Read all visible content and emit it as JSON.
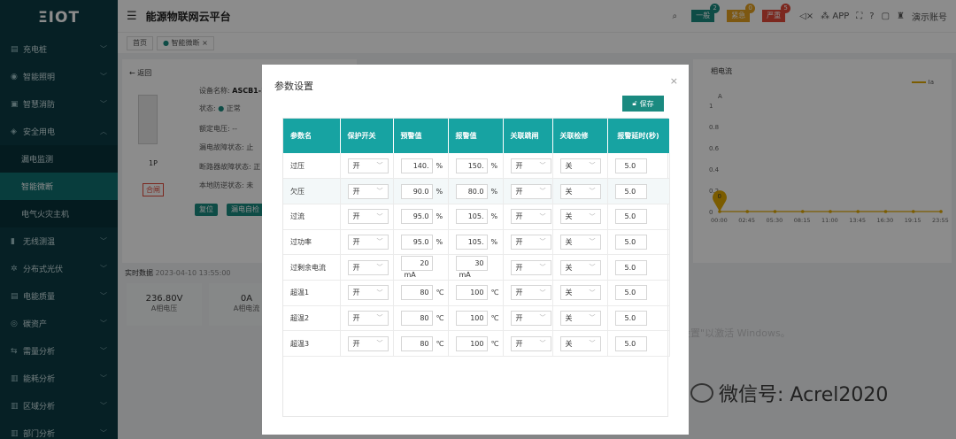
{
  "logo": "ΞIOT",
  "app_title": "能源物联网云平台",
  "sidebar": {
    "items": [
      {
        "label": "充电桩",
        "icon": "▤"
      },
      {
        "label": "智能照明",
        "icon": "◉"
      },
      {
        "label": "智慧消防",
        "icon": "▣"
      },
      {
        "label": "安全用电",
        "icon": "◈"
      },
      {
        "label": "漏电监测",
        "icon": ""
      },
      {
        "label": "智能微断",
        "icon": ""
      },
      {
        "label": "电气火灾主机",
        "icon": ""
      },
      {
        "label": "无线测温",
        "icon": "▮"
      },
      {
        "label": "分布式光伏",
        "icon": "✲"
      },
      {
        "label": "电能质量",
        "icon": "▤"
      },
      {
        "label": "碳资产",
        "icon": "◎"
      },
      {
        "label": "需量分析",
        "icon": "⇆"
      },
      {
        "label": "能耗分析",
        "icon": "▥"
      },
      {
        "label": "区域分析",
        "icon": "▥"
      },
      {
        "label": "部门分析",
        "icon": "▥"
      }
    ]
  },
  "topbar": {
    "alarms": [
      {
        "label": "一般",
        "count": "2",
        "color": "#1a8a80"
      },
      {
        "label": "紧急",
        "count": "0",
        "color": "#e4a01f"
      },
      {
        "label": "严重",
        "count": "5",
        "color": "#e24a3a"
      }
    ],
    "app_label": "APP",
    "user": "演示账号"
  },
  "tabs": [
    {
      "label": "首页"
    },
    {
      "label": "智能微断"
    }
  ],
  "device": {
    "back": "返回",
    "name_label": "设备名称:",
    "name_value": "ASCB1-1",
    "status_label": "状态:",
    "status_value": "正常",
    "voltage_label": "额定电压:",
    "voltage_value": "--",
    "leak_label": "漏电故障状态:",
    "leak_value": "止",
    "breaker_label": "断路器故障状态:",
    "breaker_value": "正",
    "local_label": "本地防逆状态:",
    "local_value": "未",
    "pole": "1P",
    "state": "合闸",
    "btn_reset": "复位",
    "btn_selfcheck": "漏电自检"
  },
  "realtime": {
    "title": "实时数据",
    "time": "2023-04-10 13:55:00",
    "cards": [
      {
        "value": "236.80V",
        "label": "A相电压"
      },
      {
        "value": "0A",
        "label": "A相电流"
      }
    ]
  },
  "chart_data": {
    "type": "line",
    "title": "相电流",
    "ylabel": "A",
    "legend": [
      "Ia"
    ],
    "x": [
      "00:00",
      "02:45",
      "05:30",
      "08:15",
      "11:00",
      "13:45",
      "16:30",
      "19:15",
      "23:55"
    ],
    "yticks": [
      "0",
      "0.2",
      "0.4",
      "0.6",
      "0.8",
      "1"
    ],
    "ylim": [
      0,
      1
    ],
    "series": [
      {
        "name": "Ia",
        "values": [
          0,
          0,
          0,
          0,
          0,
          0,
          0,
          0,
          0
        ]
      }
    ],
    "marker_value": "0",
    "color": "#e0a800",
    "grid": false
  },
  "watermark": "转到\"设置\"以激活 Windows。",
  "wechat_text": "微信号: Acrel2020",
  "modal": {
    "title": "参数设置",
    "save_label": "保存",
    "columns": [
      "参数名",
      "保护开关",
      "预警值",
      "报警值",
      "关联跳闸",
      "关联检修",
      "报警延时(秒)"
    ],
    "rows": [
      {
        "name": "过压",
        "switch": "开",
        "warn": "140.",
        "warn_unit": "%",
        "alarm": "150.",
        "alarm_unit": "%",
        "trip": "开",
        "maint": "关",
        "delay": "5.0"
      },
      {
        "name": "欠压",
        "switch": "开",
        "warn": "90.0",
        "warn_unit": "%",
        "alarm": "80.0",
        "alarm_unit": "%",
        "trip": "开",
        "maint": "关",
        "delay": "5.0"
      },
      {
        "name": "过流",
        "switch": "开",
        "warn": "95.0",
        "warn_unit": "%",
        "alarm": "105.",
        "alarm_unit": "%",
        "trip": "开",
        "maint": "关",
        "delay": "5.0"
      },
      {
        "name": "过功率",
        "switch": "开",
        "warn": "95.0",
        "warn_unit": "%",
        "alarm": "105.",
        "alarm_unit": "%",
        "trip": "开",
        "maint": "关",
        "delay": "5.0"
      },
      {
        "name": "过剩余电流",
        "switch": "开",
        "warn": "20",
        "warn_unit": "mA",
        "alarm": "30",
        "alarm_unit": "mA",
        "trip": "开",
        "maint": "关",
        "delay": "5.0"
      },
      {
        "name": "超温1",
        "switch": "开",
        "warn": "80",
        "warn_unit": "℃",
        "alarm": "100",
        "alarm_unit": "℃",
        "trip": "开",
        "maint": "关",
        "delay": "5.0"
      },
      {
        "name": "超温2",
        "switch": "开",
        "warn": "80",
        "warn_unit": "℃",
        "alarm": "100",
        "alarm_unit": "℃",
        "trip": "开",
        "maint": "关",
        "delay": "5.0"
      },
      {
        "name": "超温3",
        "switch": "开",
        "warn": "80",
        "warn_unit": "℃",
        "alarm": "100",
        "alarm_unit": "℃",
        "trip": "开",
        "maint": "关",
        "delay": "5.0"
      }
    ]
  }
}
